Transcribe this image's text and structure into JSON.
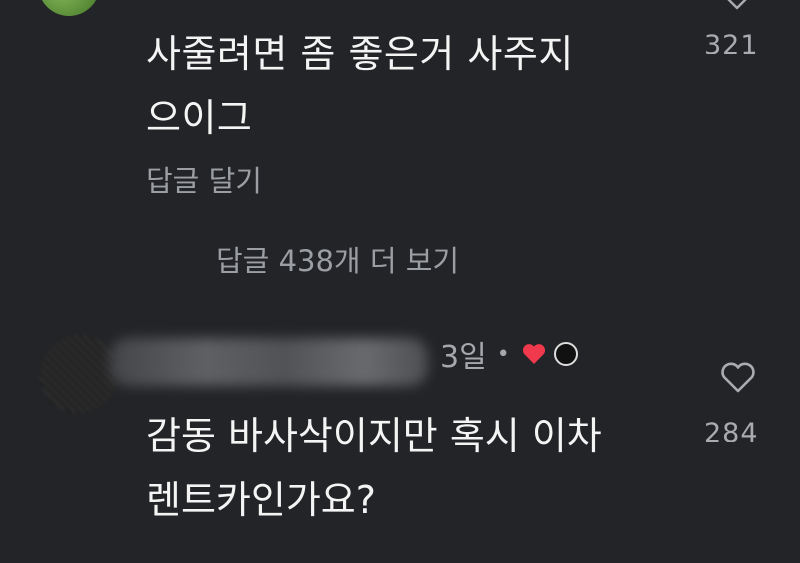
{
  "comments": [
    {
      "text_line1": "사줄려면 좀 좋은거 사주지",
      "text_line2": "으이그",
      "like_count": "321",
      "reply_label": "답글 달기",
      "more_replies_label": "답글 438개 더 보기",
      "icons": {
        "avatar": "avatar",
        "like": "heart-outline-icon"
      }
    },
    {
      "time": "3일",
      "separator": "•",
      "text_line1": "감동 바사삭이지만 혹시 이차",
      "text_line2": "렌트카인가요?",
      "like_count": "284",
      "icons": {
        "avatar": "blurred-avatar",
        "author_liked": "red-heart-icon",
        "author_avatar": "mini-avatar",
        "like": "heart-outline-icon"
      }
    }
  ],
  "colors": {
    "background": "#232427",
    "text_primary": "#f4f4f4",
    "text_secondary": "#9b9ea3",
    "heart_red": "#f0394c"
  }
}
